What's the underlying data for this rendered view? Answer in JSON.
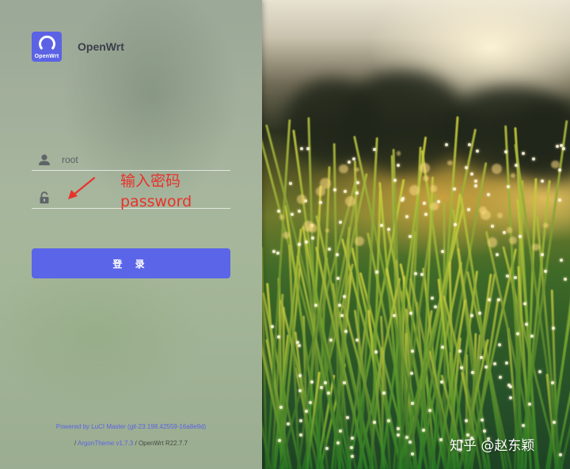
{
  "brand": {
    "logo_text": "OpenWrt",
    "name": "OpenWrt",
    "accent": "#5b63e4"
  },
  "login": {
    "username_value": "root",
    "password_value": "",
    "submit_label": "登 录",
    "user_icon": "user-icon",
    "password_icon": "unlock-icon"
  },
  "annotation": {
    "line1": "输入密码",
    "line2": "password",
    "color": "#e8322b"
  },
  "footer": {
    "powered_link": "Powered by LuCI Master (git-23.198.42559-16a8e9d)",
    "theme_link": "ArgonTheme v1.7.3",
    "separator": "/",
    "version": "OpenWrt R22.7.7"
  },
  "watermark": "知乎 @赵东颖"
}
